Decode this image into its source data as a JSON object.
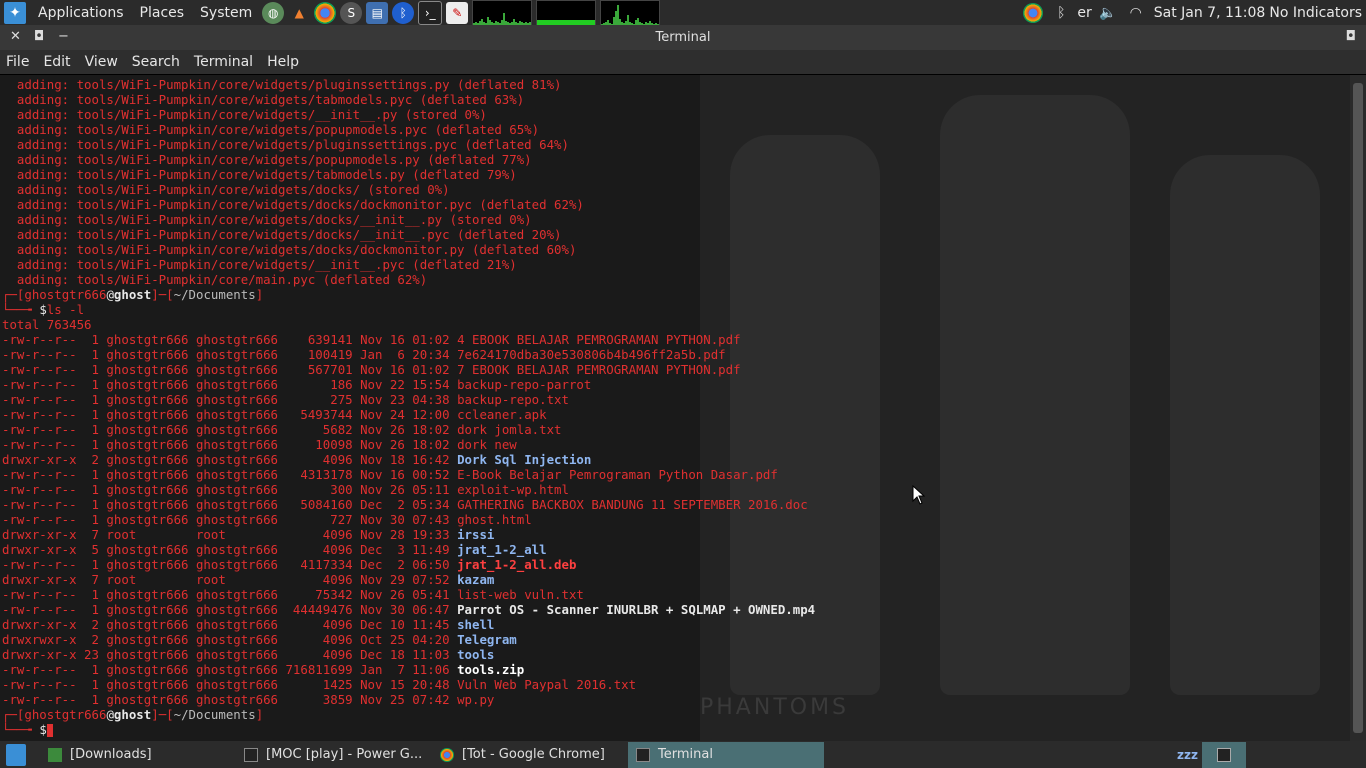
{
  "top_panel": {
    "menus": [
      "Applications",
      "Places",
      "System"
    ],
    "clock": "Sat Jan  7, 11:08",
    "indicator": "No Indicators",
    "tray_text": "er"
  },
  "window": {
    "title": "Terminal"
  },
  "menubar": [
    "File",
    "Edit",
    "View",
    "Search",
    "Terminal",
    "Help"
  ],
  "terminal": {
    "zip_output": [
      "  adding: tools/WiFi-Pumpkin/core/widgets/pluginssettings.py (deflated 81%)",
      "  adding: tools/WiFi-Pumpkin/core/widgets/tabmodels.pyc (deflated 63%)",
      "  adding: tools/WiFi-Pumpkin/core/widgets/__init__.py (stored 0%)",
      "  adding: tools/WiFi-Pumpkin/core/widgets/popupmodels.pyc (deflated 65%)",
      "  adding: tools/WiFi-Pumpkin/core/widgets/pluginssettings.pyc (deflated 64%)",
      "  adding: tools/WiFi-Pumpkin/core/widgets/popupmodels.py (deflated 77%)",
      "  adding: tools/WiFi-Pumpkin/core/widgets/tabmodels.py (deflated 79%)",
      "  adding: tools/WiFi-Pumpkin/core/widgets/docks/ (stored 0%)",
      "  adding: tools/WiFi-Pumpkin/core/widgets/docks/dockmonitor.pyc (deflated 62%)",
      "  adding: tools/WiFi-Pumpkin/core/widgets/docks/__init__.py (stored 0%)",
      "  adding: tools/WiFi-Pumpkin/core/widgets/docks/__init__.pyc (deflated 20%)",
      "  adding: tools/WiFi-Pumpkin/core/widgets/docks/dockmonitor.py (deflated 60%)",
      "  adding: tools/WiFi-Pumpkin/core/widgets/__init__.pyc (deflated 21%)",
      "  adding: tools/WiFi-Pumpkin/core/main.pyc (deflated 62%)"
    ],
    "prompt_user": "ghostgtr666",
    "prompt_host": "ghost",
    "prompt_dir": "~/Documents",
    "command": "ls -l",
    "total": "total 763456",
    "listing": [
      {
        "perm": "-rw-r--r--",
        "links": "1",
        "owner": "ghostgtr666",
        "group": "ghostgtr666",
        "size": "639141",
        "date": "Nov 16 01:02",
        "name": "4 EBOOK BELAJAR PEMROGRAMAN PYTHON.pdf",
        "kind": "file"
      },
      {
        "perm": "-rw-r--r--",
        "links": "1",
        "owner": "ghostgtr666",
        "group": "ghostgtr666",
        "size": "100419",
        "date": "Jan  6 20:34",
        "name": "7e624170dba30e530806b4b496ff2a5b.pdf",
        "kind": "file"
      },
      {
        "perm": "-rw-r--r--",
        "links": "1",
        "owner": "ghostgtr666",
        "group": "ghostgtr666",
        "size": "567701",
        "date": "Nov 16 01:02",
        "name": "7 EBOOK BELAJAR PEMROGRAMAN PYTHON.pdf",
        "kind": "file"
      },
      {
        "perm": "-rw-r--r--",
        "links": "1",
        "owner": "ghostgtr666",
        "group": "ghostgtr666",
        "size": "186",
        "date": "Nov 22 15:54",
        "name": "backup-repo-parrot",
        "kind": "file"
      },
      {
        "perm": "-rw-r--r--",
        "links": "1",
        "owner": "ghostgtr666",
        "group": "ghostgtr666",
        "size": "275",
        "date": "Nov 23 04:38",
        "name": "backup-repo.txt",
        "kind": "file"
      },
      {
        "perm": "-rw-r--r--",
        "links": "1",
        "owner": "ghostgtr666",
        "group": "ghostgtr666",
        "size": "5493744",
        "date": "Nov 24 12:00",
        "name": "ccleaner.apk",
        "kind": "file"
      },
      {
        "perm": "-rw-r--r--",
        "links": "1",
        "owner": "ghostgtr666",
        "group": "ghostgtr666",
        "size": "5682",
        "date": "Nov 26 18:02",
        "name": "dork jomla.txt",
        "kind": "file"
      },
      {
        "perm": "-rw-r--r--",
        "links": "1",
        "owner": "ghostgtr666",
        "group": "ghostgtr666",
        "size": "10098",
        "date": "Nov 26 18:02",
        "name": "dork new",
        "kind": "file"
      },
      {
        "perm": "drwxr-xr-x",
        "links": "2",
        "owner": "ghostgtr666",
        "group": "ghostgtr666",
        "size": "4096",
        "date": "Nov 18 16:42",
        "name": "Dork Sql Injection",
        "kind": "dir"
      },
      {
        "perm": "-rw-r--r--",
        "links": "1",
        "owner": "ghostgtr666",
        "group": "ghostgtr666",
        "size": "4313178",
        "date": "Nov 16 00:52",
        "name": "E-Book Belajar Pemrograman Python Dasar.pdf",
        "kind": "file"
      },
      {
        "perm": "-rw-r--r--",
        "links": "1",
        "owner": "ghostgtr666",
        "group": "ghostgtr666",
        "size": "300",
        "date": "Nov 26 05:11",
        "name": "exploit-wp.html",
        "kind": "file"
      },
      {
        "perm": "-rw-r--r--",
        "links": "1",
        "owner": "ghostgtr666",
        "group": "ghostgtr666",
        "size": "5084160",
        "date": "Dec  2 05:34",
        "name": "GATHERING BACKBOX BANDUNG 11 SEPTEMBER 2016.doc",
        "kind": "file"
      },
      {
        "perm": "-rw-r--r--",
        "links": "1",
        "owner": "ghostgtr666",
        "group": "ghostgtr666",
        "size": "727",
        "date": "Nov 30 07:43",
        "name": "ghost.html",
        "kind": "file"
      },
      {
        "perm": "drwxr-xr-x",
        "links": "7",
        "owner": "root",
        "group": "root",
        "size": "4096",
        "date": "Nov 28 19:33",
        "name": "irssi",
        "kind": "dir"
      },
      {
        "perm": "drwxr-xr-x",
        "links": "5",
        "owner": "ghostgtr666",
        "group": "ghostgtr666",
        "size": "4096",
        "date": "Dec  3 11:49",
        "name": "jrat_1-2_all",
        "kind": "dir"
      },
      {
        "perm": "-rw-r--r--",
        "links": "1",
        "owner": "ghostgtr666",
        "group": "ghostgtr666",
        "size": "4117334",
        "date": "Dec  2 06:50",
        "name": "jrat_1-2_all.deb",
        "kind": "archive"
      },
      {
        "perm": "drwxr-xr-x",
        "links": "7",
        "owner": "root",
        "group": "root",
        "size": "4096",
        "date": "Nov 29 07:52",
        "name": "kazam",
        "kind": "dir"
      },
      {
        "perm": "-rw-r--r--",
        "links": "1",
        "owner": "ghostgtr666",
        "group": "ghostgtr666",
        "size": "75342",
        "date": "Nov 26 05:41",
        "name": "list-web vuln.txt",
        "kind": "file"
      },
      {
        "perm": "-rw-r--r--",
        "links": "1",
        "owner": "ghostgtr666",
        "group": "ghostgtr666",
        "size": "44449476",
        "date": "Nov 30 06:47",
        "name": "Parrot OS - Scanner INURLBR + SQLMAP + OWNED.mp4",
        "kind": "media"
      },
      {
        "perm": "drwxr-xr-x",
        "links": "2",
        "owner": "ghostgtr666",
        "group": "ghostgtr666",
        "size": "4096",
        "date": "Dec 10 11:45",
        "name": "shell",
        "kind": "dir"
      },
      {
        "perm": "drwxrwxr-x",
        "links": "2",
        "owner": "ghostgtr666",
        "group": "ghostgtr666",
        "size": "4096",
        "date": "Oct 25 04:20",
        "name": "Telegram",
        "kind": "dir"
      },
      {
        "perm": "drwxr-xr-x",
        "links": "23",
        "owner": "ghostgtr666",
        "group": "ghostgtr666",
        "size": "4096",
        "date": "Dec 18 11:03",
        "name": "tools",
        "kind": "dir"
      },
      {
        "perm": "-rw-r--r--",
        "links": "1",
        "owner": "ghostgtr666",
        "group": "ghostgtr666",
        "size": "716811699",
        "date": "Jan  7 11:06",
        "name": "tools.zip",
        "kind": "highlight"
      },
      {
        "perm": "-rw-r--r--",
        "links": "1",
        "owner": "ghostgtr666",
        "group": "ghostgtr666",
        "size": "1425",
        "date": "Nov 15 20:48",
        "name": "Vuln Web Paypal 2016.txt",
        "kind": "file"
      },
      {
        "perm": "-rw-r--r--",
        "links": "1",
        "owner": "ghostgtr666",
        "group": "ghostgtr666",
        "size": "3859",
        "date": "Nov 25 07:42",
        "name": "wp.py",
        "kind": "file"
      }
    ],
    "background_text": "PHANTOMS"
  },
  "taskbar": {
    "tasks": [
      {
        "label": "[Downloads]",
        "icon": "folder-icon"
      },
      {
        "label": "[MOC [play] - Power G...",
        "icon": "terminal-icon"
      },
      {
        "label": "[Tot - Google Chrome]",
        "icon": "chrome-icon"
      },
      {
        "label": "Terminal",
        "icon": "terminal-icon"
      }
    ],
    "sleep_label": "zzz"
  },
  "colors": {
    "accent_red": "#e03030",
    "dir_blue": "#8fb6f0",
    "highlight": "#cc0000",
    "active_task": "#4a6f74"
  }
}
